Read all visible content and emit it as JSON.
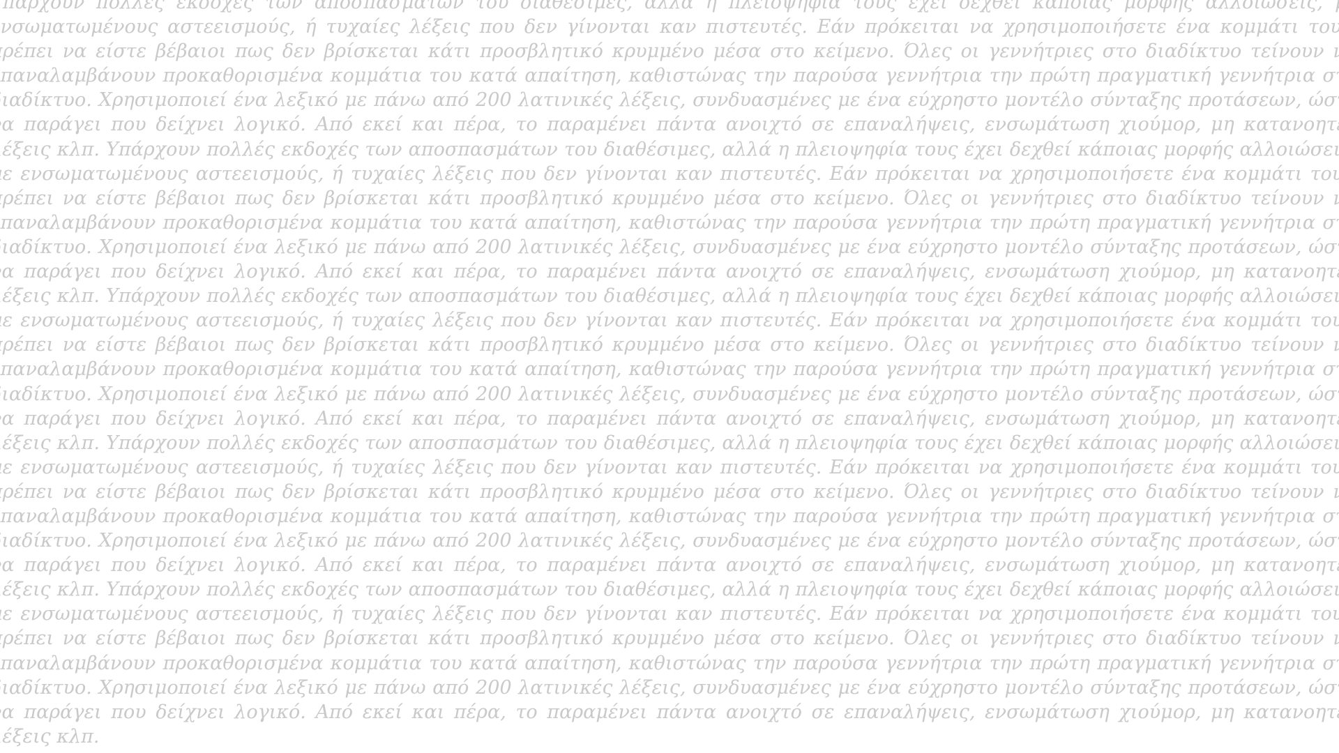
{
  "document": {
    "text_color": "#c9c9c9",
    "background_color": "#ffffff",
    "passage": "Υπάρχουν πολλές εκδοχές των αποσπασμάτων του διαθέσιμες, αλλά η πλειοψηφία τους έχει δεχθεί κάποιας μορφής αλλοιώσεις, με ενσωματωμένους αστεεισμούς, ή τυχαίες λέξεις που δεν γίνονται καν πιστευτές. Εάν πρόκειται να χρησιμοποιήσετε ένα κομμάτι του , πρέπει να είστε βέβαιοι πως δεν βρίσκεται κάτι προσβλητικό κρυμμένο μέσα στο κείμενο. Όλες οι γεννήτριες στο διαδίκτυο τείνουν να επαναλαμβάνουν προκαθορισμένα κομμάτια του κατά απαίτηση, καθιστώνας την παρούσα γεννήτρια την πρώτη πραγματική γεννήτρια στο διαδίκτυο. Χρησιμοποιεί ένα λεξικό με πάνω από 200 λατινικές λέξεις, συνδυασμένες με ένα εύχρηστο μοντέλο σύνταξης προτάσεων, ώστε να παράγει που δείχνει λογικό. Από εκεί και πέρα, το παραμένει πάντα ανοιχτό σε επαναλήψεις, ενσωμάτωση χιούμορ, μη κατανοητές λέξεις κλπ. Υπάρχουν πολλές εκδοχές των αποσπασμάτων του διαθέσιμες, αλλά η πλειοψηφία τους έχει δεχθεί κάποιας μορφής αλλοιώσεις, με ενσωματωμένους αστεεισμούς, ή τυχαίες λέξεις που δεν γίνονται καν πιστευτές. Εάν πρόκειται να χρησιμοποιήσετε ένα κομμάτι του , πρέπει να είστε βέβαιοι πως δεν βρίσκεται κάτι προσβλητικό κρυμμένο μέσα στο κείμενο. Όλες οι γεννήτριες στο διαδίκτυο τείνουν να επαναλαμβάνουν προκαθορισμένα κομμάτια του κατά απαίτηση, καθιστώνας την παρούσα γεννήτρια την πρώτη πραγματική γεννήτρια στο διαδίκτυο. Χρησιμοποιεί ένα λεξικό με πάνω από 200 λατινικές λέξεις, συνδυασμένες με ένα εύχρηστο μοντέλο σύνταξης προτάσεων, ώστε να παράγει που δείχνει λογικό. Από εκεί και πέρα, το παραμένει πάντα ανοιχτό σε επαναλήψεις, ενσωμάτωση χιούμορ, μη κατανοητές λέξεις κλπ. Υπάρχουν πολλές εκδοχές των αποσπασμάτων του διαθέσιμες, αλλά η πλειοψηφία τους έχει δεχθεί κάποιας μορφής αλλοιώσεις, με ενσωματωμένους αστεεισμούς, ή τυχαίες λέξεις που δεν γίνονται καν πιστευτές. Εάν πρόκειται να χρησιμοποιήσετε ένα κομμάτι του , πρέπει να είστε βέβαιοι πως δεν βρίσκεται κάτι προσβλητικό κρυμμένο μέσα στο κείμενο. Όλες οι γεννήτριες στο διαδίκτυο τείνουν να επαναλαμβάνουν προκαθορισμένα κομμάτια του κατά απαίτηση, καθιστώνας την παρούσα γεννήτρια την πρώτη πραγματική γεννήτρια στο διαδίκτυο. Χρησιμοποιεί ένα λεξικό με πάνω από 200 λατινικές λέξεις, συνδυασμένες με ένα εύχρηστο μοντέλο σύνταξης προτάσεων, ώστε να παράγει που δείχνει λογικό. Από εκεί και πέρα, το παραμένει πάντα ανοιχτό σε επαναλήψεις, ενσωμάτωση χιούμορ, μη κατανοητές λέξεις κλπ. Υπάρχουν πολλές εκδοχές των αποσπασμάτων του διαθέσιμες, αλλά η πλειοψηφία τους έχει δεχθεί κάποιας μορφής αλλοιώσεις, με ενσωματωμένους αστεεισμούς, ή τυχαίες λέξεις που δεν γίνονται καν πιστευτές. Εάν πρόκειται να χρησιμοποιήσετε ένα κομμάτι του , πρέπει να είστε βέβαιοι πως δεν βρίσκεται κάτι προσβλητικό κρυμμένο μέσα στο κείμενο. Όλες οι γεννήτριες στο διαδίκτυο τείνουν να επαναλαμβάνουν προκαθορισμένα κομμάτια του κατά απαίτηση, καθιστώνας την παρούσα γεννήτρια την πρώτη πραγματική γεννήτρια στο διαδίκτυο. Χρησιμοποιεί ένα λεξικό με πάνω από 200 λατινικές λέξεις, συνδυασμένες με ένα εύχρηστο μοντέλο σύνταξης προτάσεων, ώστε να παράγει που δείχνει λογικό. Από εκεί και πέρα, το παραμένει πάντα ανοιχτό σε επαναλήψεις, ενσωμάτωση χιούμορ, μη κατανοητές λέξεις κλπ. Υπάρχουν πολλές εκδοχές των αποσπασμάτων του διαθέσιμες, αλλά η πλειοψηφία τους έχει δεχθεί κάποιας μορφής αλλοιώσεις, με ενσωματωμένους αστεεισμούς, ή τυχαίες λέξεις που δεν γίνονται καν πιστευτές. Εάν πρόκειται να χρησιμοποιήσετε ένα κομμάτι του , πρέπει να είστε βέβαιοι πως δεν βρίσκεται κάτι προσβλητικό κρυμμένο μέσα στο κείμενο. Όλες οι γεννήτριες στο διαδίκτυο τείνουν να επαναλαμβάνουν προκαθορισμένα κομμάτια του κατά απαίτηση, καθιστώνας την παρούσα γεννήτρια την πρώτη πραγματική γεννήτρια στο διαδίκτυο. Χρησιμοποιεί ένα λεξικό με πάνω από 200 λατινικές λέξεις, συνδυασμένες με ένα εύχρηστο μοντέλο σύνταξης προτάσεων, ώστε να παράγει που δείχνει λογικό. Από εκεί και πέρα, το παραμένει πάντα ανοιχτό σε επαναλήψεις, ενσωμάτωση χιούμορ, μη κατανοητές λέξεις κλπ."
  }
}
